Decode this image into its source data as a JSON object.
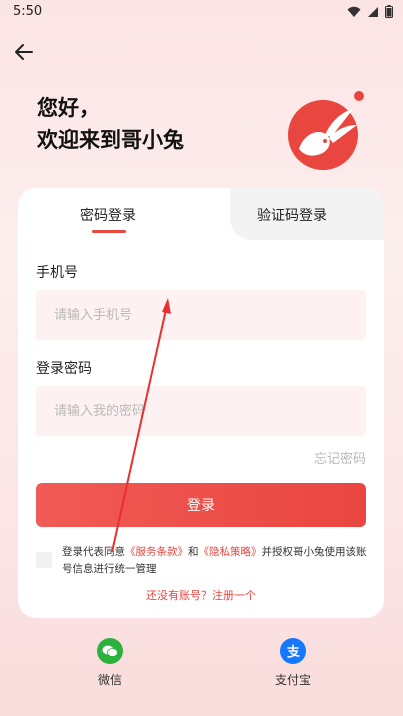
{
  "status": {
    "time": "5:50"
  },
  "greeting": {
    "line1": "您好，",
    "line2": "欢迎来到哥小兔"
  },
  "tabs": [
    {
      "label": "密码登录",
      "active": true
    },
    {
      "label": "验证码登录",
      "active": false
    }
  ],
  "form": {
    "phone_label": "手机号",
    "phone_placeholder": "请输入手机号",
    "password_label": "登录密码",
    "password_placeholder": "请输入我的密码",
    "forgot": "忘记密码",
    "login_button": "登录"
  },
  "agreement": {
    "prefix": "登录代表同意",
    "terms": "《服务条款》",
    "and": "和",
    "privacy": "《隐私策略》",
    "suffix": "并授权哥小兔使用该账号信息进行统一管理"
  },
  "register_link": "还没有账号？注册一个",
  "third_party": [
    {
      "label": "微信",
      "icon": "wechat-icon",
      "color": "#2db13d"
    },
    {
      "label": "支付宝",
      "icon": "alipay-icon",
      "color": "#1677ff"
    }
  ],
  "colors": {
    "accent": "#e8463f",
    "logo": "#e8463f"
  }
}
